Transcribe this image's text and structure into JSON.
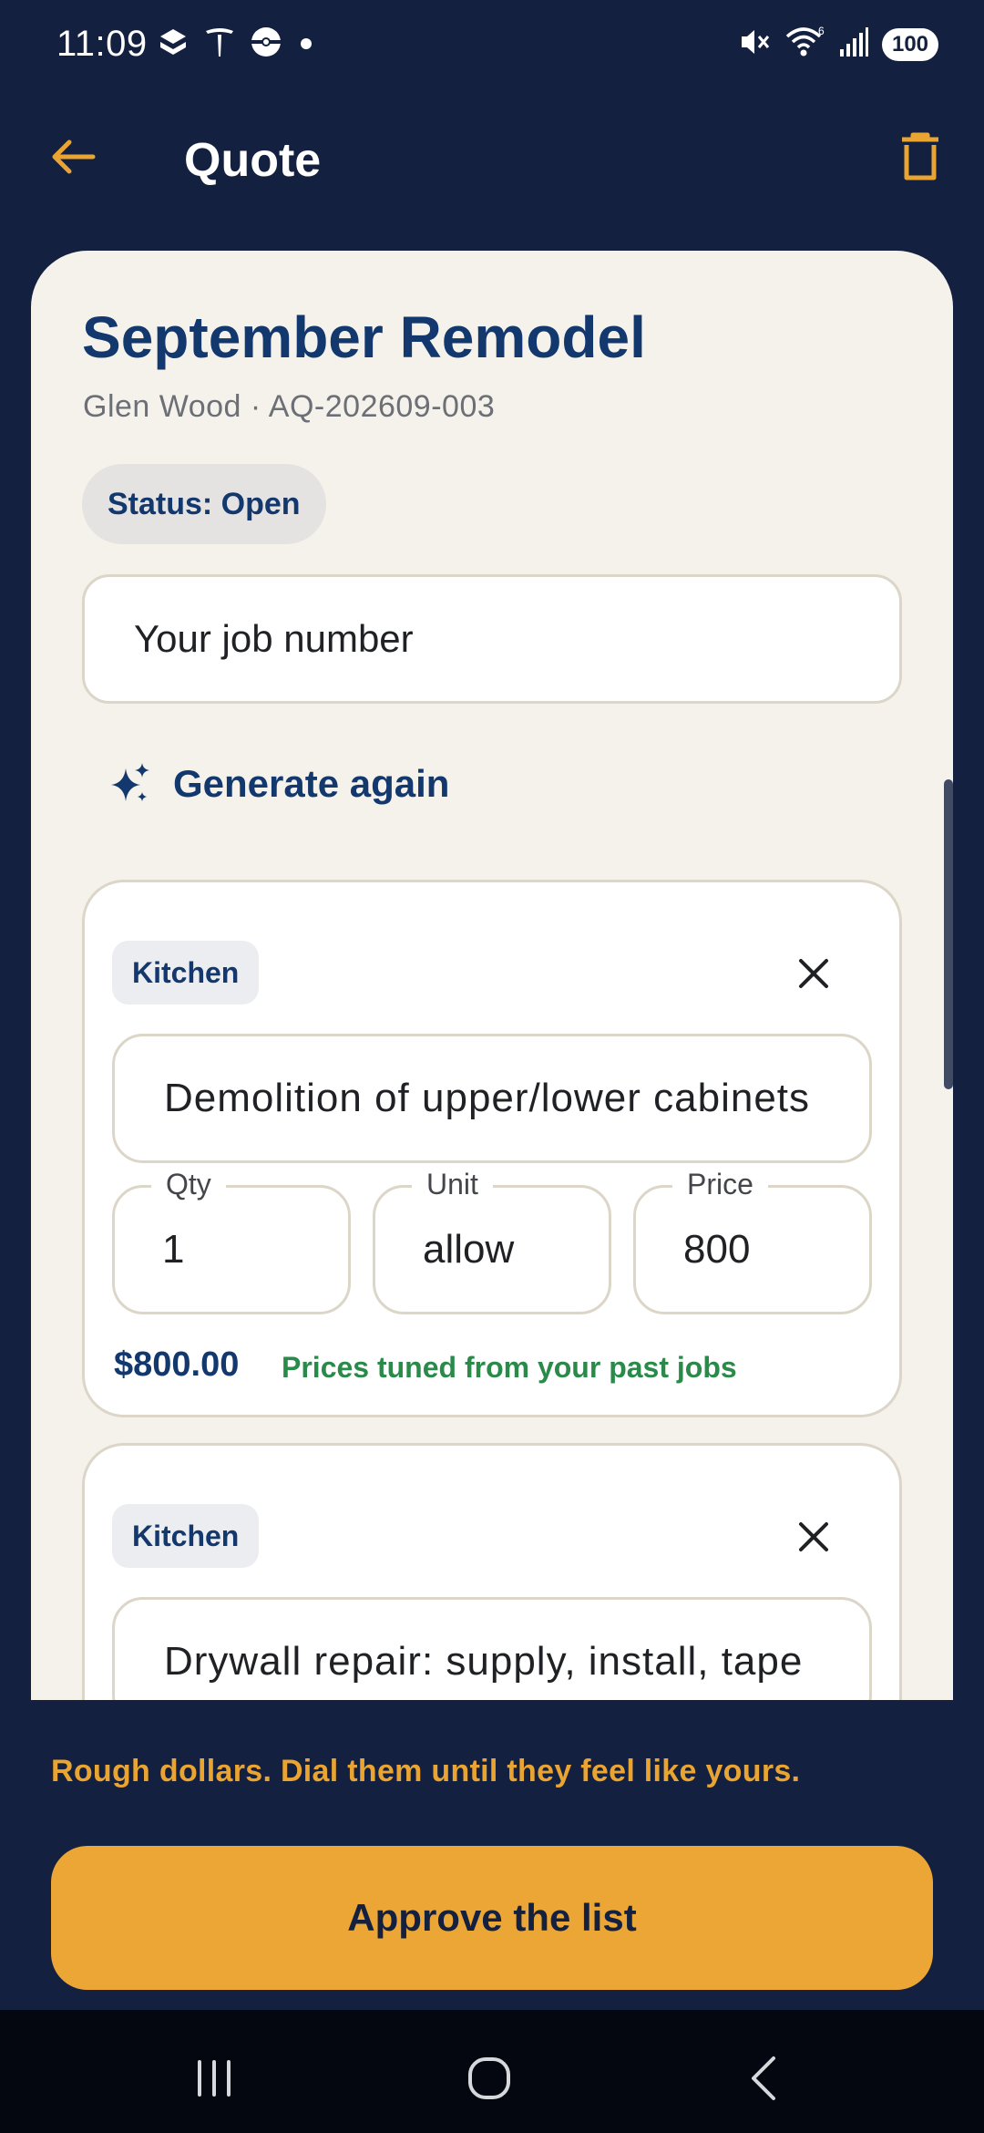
{
  "status_bar": {
    "time": "11:09",
    "battery": "100",
    "left_icons": [
      "bundle-icon",
      "tesla-icon",
      "pokeball-icon",
      "dot-icon"
    ],
    "right_icons": [
      "mute-icon",
      "wifi-icon",
      "signal-icon"
    ]
  },
  "app_bar": {
    "title": "Quote"
  },
  "quote": {
    "title": "September Remodel",
    "subtitle": "Glen Wood · AQ-202609-003",
    "status": "Status: Open",
    "job_number_placeholder": "Your job number",
    "generate_label": "Generate again"
  },
  "items": [
    {
      "room": "Kitchen",
      "description": "Demolition of upper/lower cabinets",
      "qty_label": "Qty",
      "qty": "1",
      "unit_label": "Unit",
      "unit": "allow",
      "price_label": "Price",
      "price": "800",
      "total": "$800.00",
      "note": "Prices tuned from your past jobs"
    },
    {
      "room": "Kitchen",
      "description": "Drywall repair: supply, install, tape"
    }
  ],
  "footer": {
    "hint": "Rough dollars. Dial them until they feel like yours.",
    "approve_label": "Approve the list"
  },
  "colors": {
    "background": "#13203f",
    "accent": "#eba636",
    "title_blue": "#13386e",
    "success_green": "#2a8a4a",
    "card": "#f5f2ec"
  }
}
